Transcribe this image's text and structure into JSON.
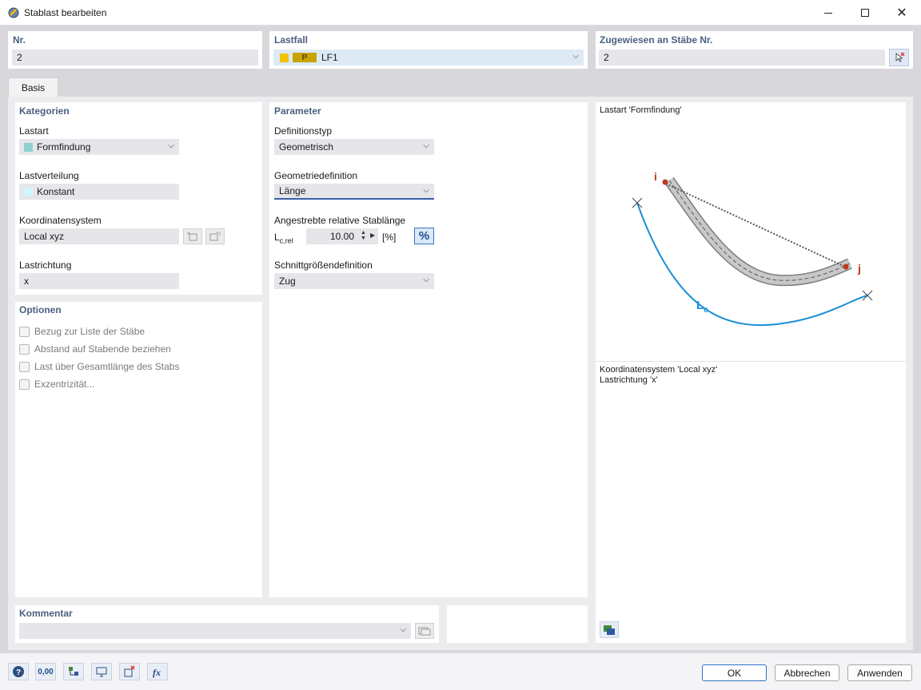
{
  "window": {
    "title": "Stablast bearbeiten",
    "minimize_icon": "minimize-icon",
    "maximize_icon": "maximize-icon",
    "close_icon": "close-icon"
  },
  "header": {
    "nr_label": "Nr.",
    "nr_value": "2",
    "lastfall_label": "Lastfall",
    "lastfall_tag": "P",
    "lastfall_value": "LF1",
    "zugewiesen_label": "Zugewiesen an Stäbe Nr.",
    "zugewiesen_value": "2"
  },
  "tabs": [
    {
      "label": "Basis"
    }
  ],
  "kategorien": {
    "title": "Kategorien",
    "lastart_label": "Lastart",
    "lastart_value": "Formfindung",
    "lastverteilung_label": "Lastverteilung",
    "lastverteilung_value": "Konstant",
    "koordinatensystem_label": "Koordinatensystem",
    "koordinatensystem_value": "Local xyz",
    "lastrichtung_label": "Lastrichtung",
    "lastrichtung_value": "x"
  },
  "optionen": {
    "title": "Optionen",
    "items": [
      {
        "label": "Bezug zur Liste der Stäbe"
      },
      {
        "label": "Abstand auf Stabende beziehen"
      },
      {
        "label": "Last über Gesamtlänge des Stabs"
      },
      {
        "label": "Exzentrizität..."
      }
    ]
  },
  "parameter": {
    "title": "Parameter",
    "definitionstyp_label": "Definitionstyp",
    "definitionstyp_value": "Geometrisch",
    "geometriedefinition_label": "Geometriedefinition",
    "geometriedefinition_value": "Länge",
    "stablaenge_label": "Angestrebte relative Stablänge",
    "lcrel_main": "L",
    "lcrel_sub": "c,rel",
    "lcrel_value": "10.00",
    "lcrel_unit": "[%]",
    "percent_button": "%",
    "schnitt_label": "Schnittgrößendefinition",
    "schnitt_value": "Zug"
  },
  "preview": {
    "title": "Lastart 'Formfindung'",
    "label_i": "i",
    "label_j": "j",
    "label_lc_main": "L",
    "label_lc_sub": "c",
    "info_line1": "Koordinatensystem 'Local xyz'",
    "info_line2": "Lastrichtung 'x'"
  },
  "kommentar": {
    "title": "Kommentar",
    "value": ""
  },
  "footer": {
    "tools_value": "0,00",
    "ok_label": "OK",
    "cancel_label": "Abbrechen",
    "apply_label": "Anwenden"
  },
  "colors": {
    "lastfall_swatch": "#f2c200",
    "lastfall_tag": "#c9a300",
    "formfindung_swatch": "#8fcfcf",
    "konstant_swatch": "#cff6f8",
    "section_title": "#4a6080",
    "cable": "#1b8fd6",
    "node": "#c0391b"
  }
}
